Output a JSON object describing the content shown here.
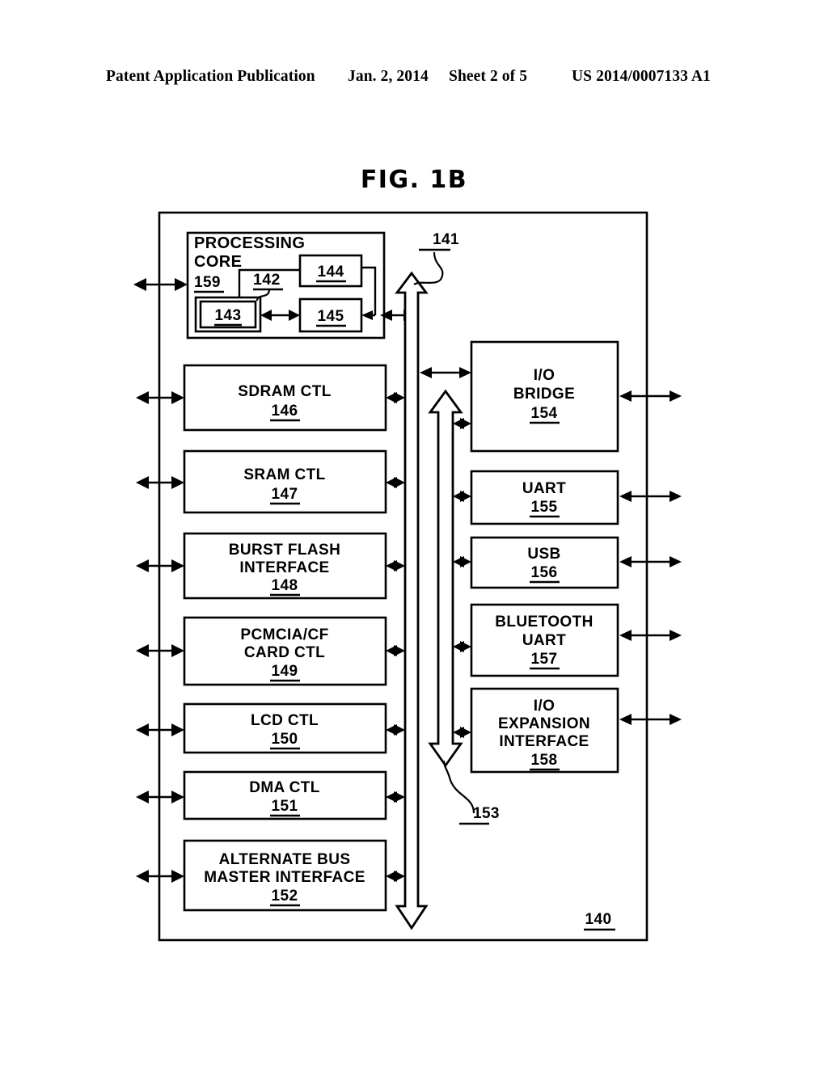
{
  "header": {
    "publication": "Patent Application Publication",
    "date": "Jan. 2, 2014",
    "sheet": "Sheet 2 of 5",
    "patent_number": "US 2014/0007133 A1"
  },
  "figure": {
    "title": "FIG. 1B",
    "outer_ref": "140",
    "bus_main_ref": "141",
    "bus_secondary_ref": "153",
    "core": {
      "title_line1": "PROCESSING",
      "title_line2": "CORE",
      "ref": "159",
      "cache_ref": "142",
      "blocks": [
        {
          "ref": "143"
        },
        {
          "ref": "144"
        },
        {
          "ref": "145"
        }
      ]
    },
    "left_blocks": [
      {
        "lines": [
          "SDRAM CTL"
        ],
        "ref": "146"
      },
      {
        "lines": [
          "SRAM CTL"
        ],
        "ref": "147"
      },
      {
        "lines": [
          "BURST FLASH",
          "INTERFACE"
        ],
        "ref": "148"
      },
      {
        "lines": [
          "PCMCIA/CF",
          "CARD CTL"
        ],
        "ref": "149"
      },
      {
        "lines": [
          "LCD CTL"
        ],
        "ref": "150"
      },
      {
        "lines": [
          "DMA CTL"
        ],
        "ref": "151"
      },
      {
        "lines": [
          "ALTERNATE BUS",
          "MASTER INTERFACE"
        ],
        "ref": "152"
      }
    ],
    "right_blocks": [
      {
        "lines": [
          "I/O",
          "BRIDGE"
        ],
        "ref": "154"
      },
      {
        "lines": [
          "UART"
        ],
        "ref": "155"
      },
      {
        "lines": [
          "USB"
        ],
        "ref": "156"
      },
      {
        "lines": [
          "BLUETOOTH",
          "UART"
        ],
        "ref": "157"
      },
      {
        "lines": [
          "I/O",
          "EXPANSION",
          "INTERFACE"
        ],
        "ref": "158"
      }
    ]
  }
}
